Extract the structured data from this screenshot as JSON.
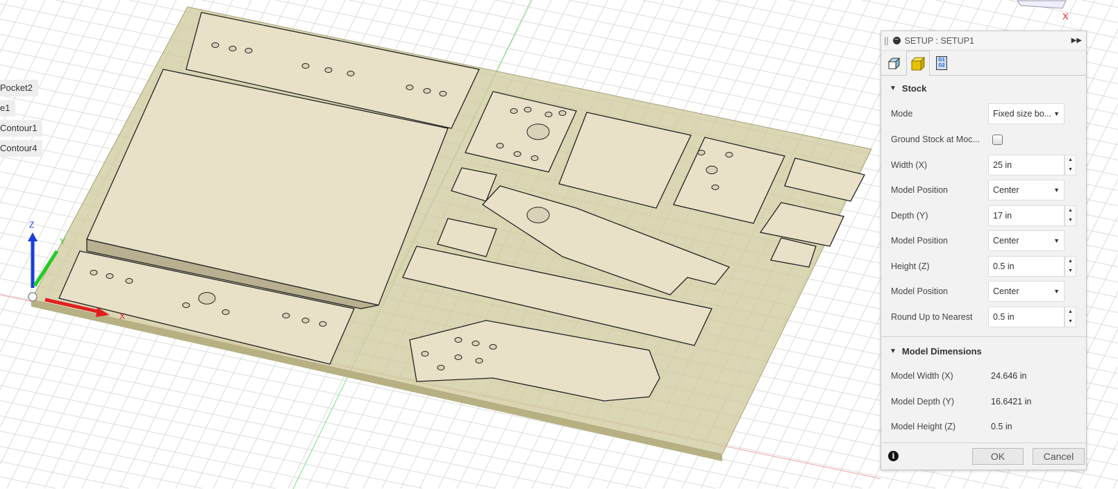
{
  "browser": {
    "items": [
      "Pocket2",
      "e1",
      "Contour1",
      "Contour4"
    ]
  },
  "triad": {
    "x": "X",
    "y": "Y",
    "z": "Z"
  },
  "viewcube": {
    "x_label": "X"
  },
  "panel": {
    "title": "SETUP : SETUP1",
    "tabs": [
      {
        "name": "setup",
        "icon": "setup-icon"
      },
      {
        "name": "stock",
        "icon": "stock-cube-icon",
        "active": true
      },
      {
        "name": "post-process",
        "icon": "g1g2-icon",
        "text1": "G1",
        "text2": "G2"
      }
    ],
    "stock": {
      "header": "Stock",
      "mode_label": "Mode",
      "mode_value": "Fixed size bo...",
      "ground_label": "Ground Stock at Moc...",
      "ground_checked": false,
      "width_label": "Width (X)",
      "width_value": "25 in",
      "width_pos_label": "Model Position",
      "width_pos_value": "Center",
      "depth_label": "Depth (Y)",
      "depth_value": "17 in",
      "depth_pos_label": "Model Position",
      "depth_pos_value": "Center",
      "height_label": "Height (Z)",
      "height_value": "0.5 in",
      "height_pos_label": "Model Position",
      "height_pos_value": "Center",
      "round_label": "Round Up to Nearest",
      "round_value": "0.5 in"
    },
    "model": {
      "header": "Model Dimensions",
      "width_label": "Model Width (X)",
      "width_value": "24.646 in",
      "depth_label": "Model Depth (Y)",
      "depth_value": "16.6421 in",
      "height_label": "Model Height (Z)",
      "height_value": "0.5 in"
    },
    "ok": "OK",
    "cancel": "Cancel"
  },
  "colors": {
    "stock": "#c9c38f",
    "part": "#e9e2cb",
    "x_axis": "#e02020",
    "y_axis": "#22cc22",
    "z_axis": "#1a3ddb"
  }
}
